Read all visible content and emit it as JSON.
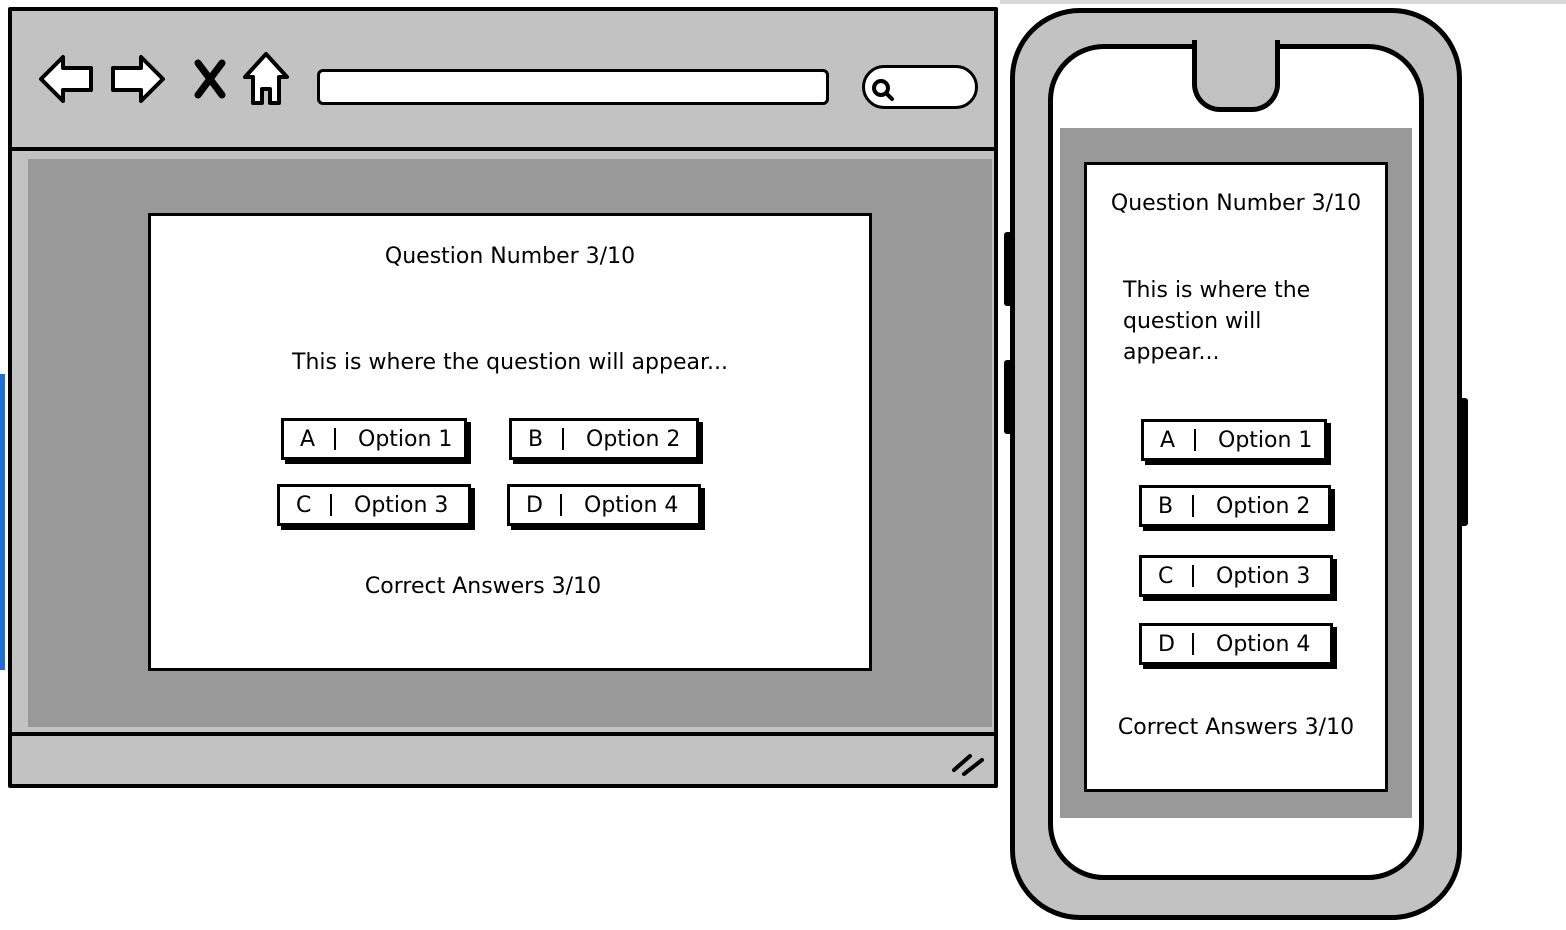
{
  "browser": {
    "toolbar": {
      "back_icon": "back-arrow-icon",
      "forward_icon": "forward-arrow-icon",
      "close_icon": "close-icon",
      "home_icon": "home-icon",
      "search_icon": "search-icon",
      "url_value": ""
    },
    "quiz": {
      "question_number": "Question Number 3/10",
      "question_text": "This is where the question will appear...",
      "options": [
        {
          "letter": "A",
          "label": "Option 1"
        },
        {
          "letter": "B",
          "label": "Option 2"
        },
        {
          "letter": "C",
          "label": "Option 3"
        },
        {
          "letter": "D",
          "label": "Option 4"
        }
      ],
      "score": "Correct Answers 3/10"
    }
  },
  "phone": {
    "quiz": {
      "question_number": "Question Number 3/10",
      "question_text_lines": [
        "This is where the",
        "question will",
        "appear..."
      ],
      "options": [
        {
          "letter": "A",
          "label": "Option 1"
        },
        {
          "letter": "B",
          "label": "Option 2"
        },
        {
          "letter": "C",
          "label": "Option 3"
        },
        {
          "letter": "D",
          "label": "Option 4"
        }
      ],
      "score": "Correct Answers 3/10"
    }
  },
  "colors": {
    "frame_gray": "#c2c2c2",
    "viewport_gray": "#999999",
    "accent_blue": "#1d6fd6"
  }
}
